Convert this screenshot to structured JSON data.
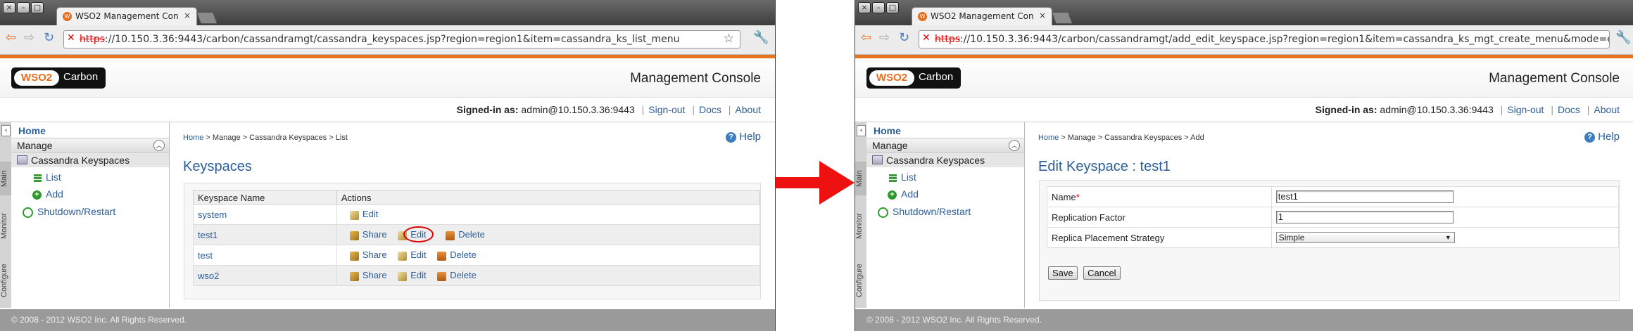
{
  "arrow": {
    "color": "#ee1111"
  },
  "left": {
    "tab_title": "WSO2 Management Conso",
    "url_struck": "https",
    "url_rest": "://10.150.3.36:9443/carbon/cassandramgt/cassandra_keyspaces.jsp?region=region1&item=cassandra_ks_list_menu",
    "logo_wso": "WSO2",
    "logo_carbon": "Carbon",
    "console_title": "Management Console",
    "signed_in_label": "Signed-in as:",
    "signed_in_user": "admin@10.150.3.36:9443",
    "signout": "Sign-out",
    "docs": "Docs",
    "about": "About",
    "vtabs": [
      "Main",
      "Monitor",
      "Configure"
    ],
    "menu": {
      "home": "Home",
      "manage": "Manage",
      "keyspaces": "Cassandra Keyspaces",
      "list": "List",
      "add": "Add",
      "shutdown": "Shutdown/Restart"
    },
    "breadcrumb": {
      "home": "Home",
      "rest": " > Manage > Cassandra Keyspaces > List"
    },
    "help": "Help",
    "page_title": "Keyspaces",
    "table": {
      "headers": [
        "Keyspace Name",
        "Actions"
      ],
      "rows": [
        {
          "name": "system",
          "actions": [
            "Edit"
          ]
        },
        {
          "name": "test1",
          "actions": [
            "Share",
            "Edit",
            "Delete"
          ]
        },
        {
          "name": "test",
          "actions": [
            "Share",
            "Edit",
            "Delete"
          ]
        },
        {
          "name": "wso2",
          "actions": [
            "Share",
            "Edit",
            "Delete"
          ]
        }
      ]
    },
    "footer": "© 2008 - 2012 WSO2 Inc. All Rights Reserved."
  },
  "right": {
    "tab_title": "WSO2 Management Conso",
    "url_struck": "https",
    "url_rest": "://10.150.3.36:9443/carbon/cassandramgt/add_edit_keyspace.jsp?region=region1&item=cassandra_ks_mgt_create_menu&mode=e",
    "logo_wso": "WSO2",
    "logo_carbon": "Carbon",
    "console_title": "Management Console",
    "signed_in_label": "Signed-in as:",
    "signed_in_user": "admin@10.150.3.36:9443",
    "signout": "Sign-out",
    "docs": "Docs",
    "about": "About",
    "vtabs": [
      "Main",
      "Monitor",
      "Configure"
    ],
    "menu": {
      "home": "Home",
      "manage": "Manage",
      "keyspaces": "Cassandra Keyspaces",
      "list": "List",
      "add": "Add",
      "shutdown": "Shutdown/Restart"
    },
    "breadcrumb": {
      "home": "Home",
      "rest": " > Manage > Cassandra Keyspaces > Add"
    },
    "help": "Help",
    "page_title": "Edit Keyspace : test1",
    "form": {
      "name_label": "Name",
      "name_required": "*",
      "name_value": "test1",
      "rf_label": "Replication Factor",
      "rf_value": "1",
      "strategy_label": "Replica Placement Strategy",
      "strategy_value": "Simple"
    },
    "save": "Save",
    "cancel": "Cancel",
    "footer": "© 2008 - 2012 WSO2 Inc. All Rights Reserved."
  }
}
